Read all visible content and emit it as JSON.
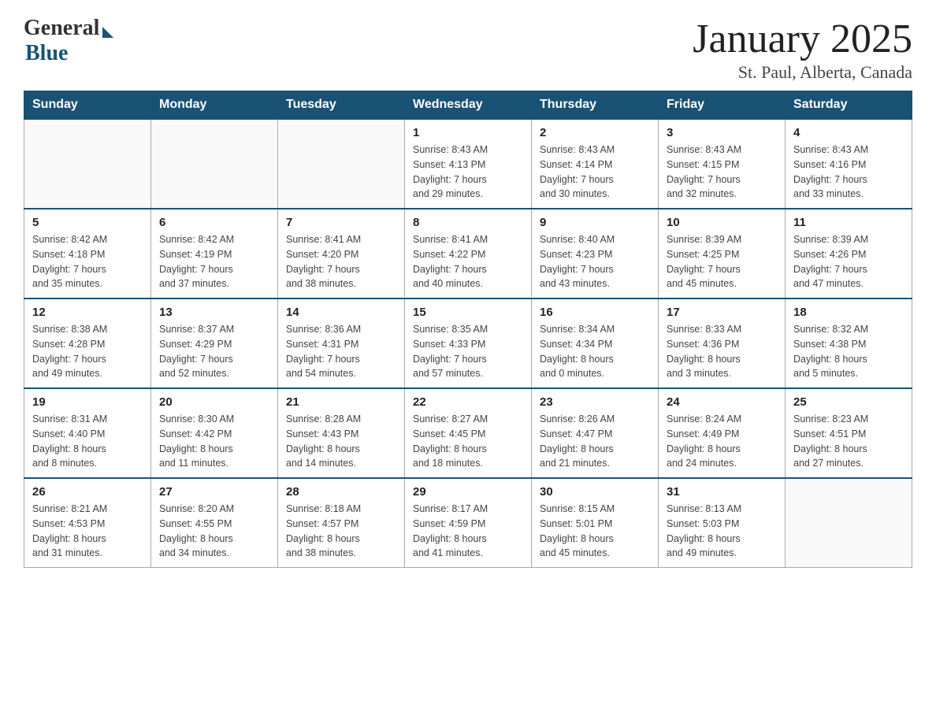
{
  "header": {
    "logo_general": "General",
    "logo_blue": "Blue",
    "title": "January 2025",
    "subtitle": "St. Paul, Alberta, Canada"
  },
  "calendar": {
    "days_of_week": [
      "Sunday",
      "Monday",
      "Tuesday",
      "Wednesday",
      "Thursday",
      "Friday",
      "Saturday"
    ],
    "weeks": [
      [
        {
          "day": "",
          "info": ""
        },
        {
          "day": "",
          "info": ""
        },
        {
          "day": "",
          "info": ""
        },
        {
          "day": "1",
          "info": "Sunrise: 8:43 AM\nSunset: 4:13 PM\nDaylight: 7 hours\nand 29 minutes."
        },
        {
          "day": "2",
          "info": "Sunrise: 8:43 AM\nSunset: 4:14 PM\nDaylight: 7 hours\nand 30 minutes."
        },
        {
          "day": "3",
          "info": "Sunrise: 8:43 AM\nSunset: 4:15 PM\nDaylight: 7 hours\nand 32 minutes."
        },
        {
          "day": "4",
          "info": "Sunrise: 8:43 AM\nSunset: 4:16 PM\nDaylight: 7 hours\nand 33 minutes."
        }
      ],
      [
        {
          "day": "5",
          "info": "Sunrise: 8:42 AM\nSunset: 4:18 PM\nDaylight: 7 hours\nand 35 minutes."
        },
        {
          "day": "6",
          "info": "Sunrise: 8:42 AM\nSunset: 4:19 PM\nDaylight: 7 hours\nand 37 minutes."
        },
        {
          "day": "7",
          "info": "Sunrise: 8:41 AM\nSunset: 4:20 PM\nDaylight: 7 hours\nand 38 minutes."
        },
        {
          "day": "8",
          "info": "Sunrise: 8:41 AM\nSunset: 4:22 PM\nDaylight: 7 hours\nand 40 minutes."
        },
        {
          "day": "9",
          "info": "Sunrise: 8:40 AM\nSunset: 4:23 PM\nDaylight: 7 hours\nand 43 minutes."
        },
        {
          "day": "10",
          "info": "Sunrise: 8:39 AM\nSunset: 4:25 PM\nDaylight: 7 hours\nand 45 minutes."
        },
        {
          "day": "11",
          "info": "Sunrise: 8:39 AM\nSunset: 4:26 PM\nDaylight: 7 hours\nand 47 minutes."
        }
      ],
      [
        {
          "day": "12",
          "info": "Sunrise: 8:38 AM\nSunset: 4:28 PM\nDaylight: 7 hours\nand 49 minutes."
        },
        {
          "day": "13",
          "info": "Sunrise: 8:37 AM\nSunset: 4:29 PM\nDaylight: 7 hours\nand 52 minutes."
        },
        {
          "day": "14",
          "info": "Sunrise: 8:36 AM\nSunset: 4:31 PM\nDaylight: 7 hours\nand 54 minutes."
        },
        {
          "day": "15",
          "info": "Sunrise: 8:35 AM\nSunset: 4:33 PM\nDaylight: 7 hours\nand 57 minutes."
        },
        {
          "day": "16",
          "info": "Sunrise: 8:34 AM\nSunset: 4:34 PM\nDaylight: 8 hours\nand 0 minutes."
        },
        {
          "day": "17",
          "info": "Sunrise: 8:33 AM\nSunset: 4:36 PM\nDaylight: 8 hours\nand 3 minutes."
        },
        {
          "day": "18",
          "info": "Sunrise: 8:32 AM\nSunset: 4:38 PM\nDaylight: 8 hours\nand 5 minutes."
        }
      ],
      [
        {
          "day": "19",
          "info": "Sunrise: 8:31 AM\nSunset: 4:40 PM\nDaylight: 8 hours\nand 8 minutes."
        },
        {
          "day": "20",
          "info": "Sunrise: 8:30 AM\nSunset: 4:42 PM\nDaylight: 8 hours\nand 11 minutes."
        },
        {
          "day": "21",
          "info": "Sunrise: 8:28 AM\nSunset: 4:43 PM\nDaylight: 8 hours\nand 14 minutes."
        },
        {
          "day": "22",
          "info": "Sunrise: 8:27 AM\nSunset: 4:45 PM\nDaylight: 8 hours\nand 18 minutes."
        },
        {
          "day": "23",
          "info": "Sunrise: 8:26 AM\nSunset: 4:47 PM\nDaylight: 8 hours\nand 21 minutes."
        },
        {
          "day": "24",
          "info": "Sunrise: 8:24 AM\nSunset: 4:49 PM\nDaylight: 8 hours\nand 24 minutes."
        },
        {
          "day": "25",
          "info": "Sunrise: 8:23 AM\nSunset: 4:51 PM\nDaylight: 8 hours\nand 27 minutes."
        }
      ],
      [
        {
          "day": "26",
          "info": "Sunrise: 8:21 AM\nSunset: 4:53 PM\nDaylight: 8 hours\nand 31 minutes."
        },
        {
          "day": "27",
          "info": "Sunrise: 8:20 AM\nSunset: 4:55 PM\nDaylight: 8 hours\nand 34 minutes."
        },
        {
          "day": "28",
          "info": "Sunrise: 8:18 AM\nSunset: 4:57 PM\nDaylight: 8 hours\nand 38 minutes."
        },
        {
          "day": "29",
          "info": "Sunrise: 8:17 AM\nSunset: 4:59 PM\nDaylight: 8 hours\nand 41 minutes."
        },
        {
          "day": "30",
          "info": "Sunrise: 8:15 AM\nSunset: 5:01 PM\nDaylight: 8 hours\nand 45 minutes."
        },
        {
          "day": "31",
          "info": "Sunrise: 8:13 AM\nSunset: 5:03 PM\nDaylight: 8 hours\nand 49 minutes."
        },
        {
          "day": "",
          "info": ""
        }
      ]
    ]
  }
}
